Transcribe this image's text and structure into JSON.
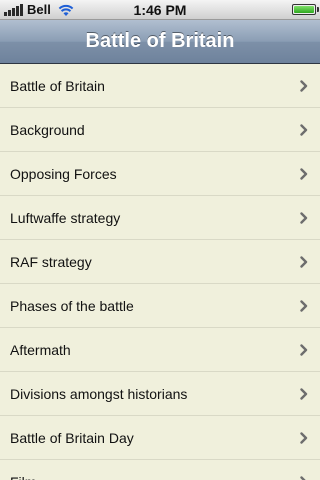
{
  "status_bar": {
    "carrier": "Bell",
    "time": "1:46 PM",
    "signal_icon": "signal-bars-icon",
    "wifi_icon": "wifi-icon",
    "battery_icon": "battery-icon",
    "battery_level": 1.0
  },
  "nav": {
    "title": "Battle of Britain"
  },
  "list": {
    "chevron_icon": "chevron-right-icon",
    "chevron_color": "#6d6d6d",
    "items": [
      {
        "label": "Battle of Britain"
      },
      {
        "label": "Background"
      },
      {
        "label": "Opposing Forces"
      },
      {
        "label": "Luftwaffe strategy"
      },
      {
        "label": "RAF strategy"
      },
      {
        "label": "Phases of the battle"
      },
      {
        "label": "Aftermath"
      },
      {
        "label": "Divisions amongst historians"
      },
      {
        "label": "Battle of Britain Day"
      },
      {
        "label": "Film"
      }
    ]
  },
  "colors": {
    "list_background": "#f0f0dc",
    "nav_gradient_top": "#b1bfd0",
    "nav_gradient_bottom": "#6e829c"
  }
}
